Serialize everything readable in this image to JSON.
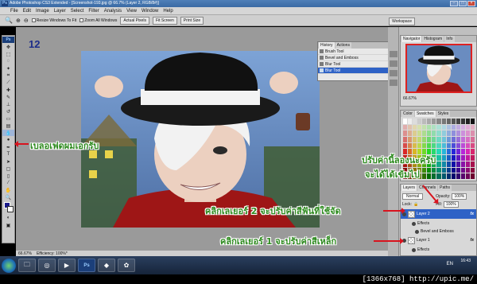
{
  "window": {
    "title": "Adobe Photoshop CS3 Extended - [Screenshot-193.jpg @ 66.7% (Layer 2, RGB/8#)]",
    "app_icon": "Ps"
  },
  "menu": [
    "File",
    "Edit",
    "Image",
    "Layer",
    "Select",
    "Filter",
    "Analysis",
    "View",
    "Window",
    "Help"
  ],
  "options_bar": {
    "resize_windows": "Resize Windows To Fit",
    "zoom_all": "Zoom All Windows",
    "actual_pixels": "Actual Pixels",
    "fit_screen": "Fit Screen",
    "print_size": "Print Size",
    "workspace": "Workspace"
  },
  "step_number": "12",
  "history_panel": {
    "tabs": [
      "History",
      "Actions"
    ],
    "items": [
      {
        "label": "Brush Tool",
        "selected": false
      },
      {
        "label": "Bevel and Emboss",
        "selected": false
      },
      {
        "label": "Blur Tool",
        "selected": false
      },
      {
        "label": "Blur Tool",
        "selected": true
      }
    ]
  },
  "navigator_panel": {
    "tabs": [
      "Navigator",
      "Histogram",
      "Info"
    ],
    "zoom": "66.67%"
  },
  "color_panel": {
    "tabs": [
      "Color",
      "Swatches",
      "Styles"
    ]
  },
  "layers_panel": {
    "tabs": [
      "Layers",
      "Channels",
      "Paths"
    ],
    "blend_mode": "Normal",
    "opacity_label": "Opacity:",
    "opacity": "100%",
    "lock_label": "Lock:",
    "fill_label": "Fill:",
    "fill": "100%",
    "layers": [
      {
        "name": "Layer 2",
        "selected": true,
        "fx": "fx"
      },
      {
        "name": "Effects",
        "selected": false,
        "fx": ""
      },
      {
        "name": "Bevel and Emboss",
        "selected": false,
        "fx": ""
      },
      {
        "name": "Layer 1",
        "selected": false,
        "fx": "fx"
      },
      {
        "name": "Effects",
        "selected": false,
        "fx": ""
      }
    ]
  },
  "status_bar": {
    "zoom": "66.67%",
    "efficiency": "Efficiency: 100%*"
  },
  "annotations": {
    "blur_tool": "เบลอเฟดผมเอกรับ",
    "adjust_values": "ปรับค่านี้ลองนะครับ",
    "adjust_values_2": "จะได้ได้เข้มไป",
    "click_layer2": "คลิกเลเยอร์ 2 จะปรับค่าสีฟันที่ใช้จัด",
    "click_layer1": "คลิกเลเยอร์ 1 จะปรับค่าสีเหล็ก"
  },
  "taskbar": {
    "time": "16:43",
    "language": "EN"
  },
  "watermark": "[1366x768] http://upic.me/",
  "colors": {
    "annotation_text": "#2d8a1e",
    "arrow": "#d8141e",
    "selection": "#2e62c6",
    "step_number": "#1e2d8a"
  }
}
